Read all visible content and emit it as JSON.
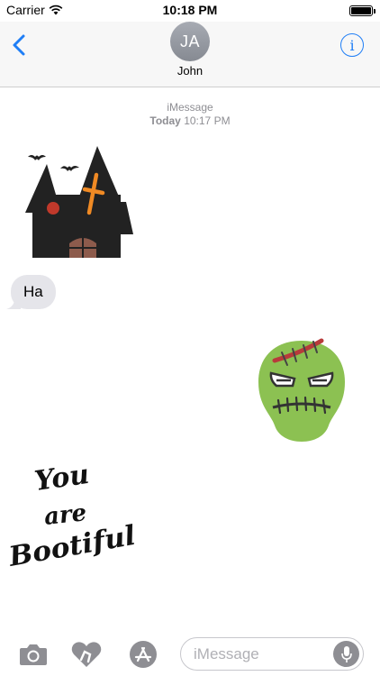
{
  "status_bar": {
    "carrier": "Carrier",
    "time": "10:18 PM",
    "battery_level": 1.0,
    "icons": [
      "wifi-icon",
      "battery-icon"
    ]
  },
  "nav": {
    "back_icon": "chevron-left-icon",
    "avatar_initials": "JA",
    "contact_name": "John",
    "info_label": "i"
  },
  "thread": {
    "service": "iMessage",
    "day": "Today",
    "time": "10:17 PM"
  },
  "messages": [
    {
      "type": "sticker",
      "from": "them",
      "icon": "haunted-house-sticker"
    },
    {
      "type": "text",
      "from": "them",
      "text": "Ha"
    },
    {
      "type": "sticker",
      "from": "me",
      "icon": "zombie-head-sticker"
    },
    {
      "type": "sticker",
      "from": "them",
      "icon": "you-are-bootiful-sticker",
      "text_lines": [
        "You",
        "are",
        "Bootiful"
      ]
    }
  ],
  "input_bar": {
    "placeholder": "iMessage",
    "icons": [
      "camera-icon",
      "digital-touch-icon",
      "app-store-icon",
      "microphone-icon"
    ]
  },
  "colors": {
    "accent": "#1f7ef6",
    "bubble_received": "#e5e5ea",
    "nav_background": "#f7f7f7",
    "timestamp": "#8e8e93",
    "zombie_skin": "#8cc152",
    "house_body": "#222222",
    "house_window": "#c0392b",
    "house_cross": "#f08a24"
  }
}
